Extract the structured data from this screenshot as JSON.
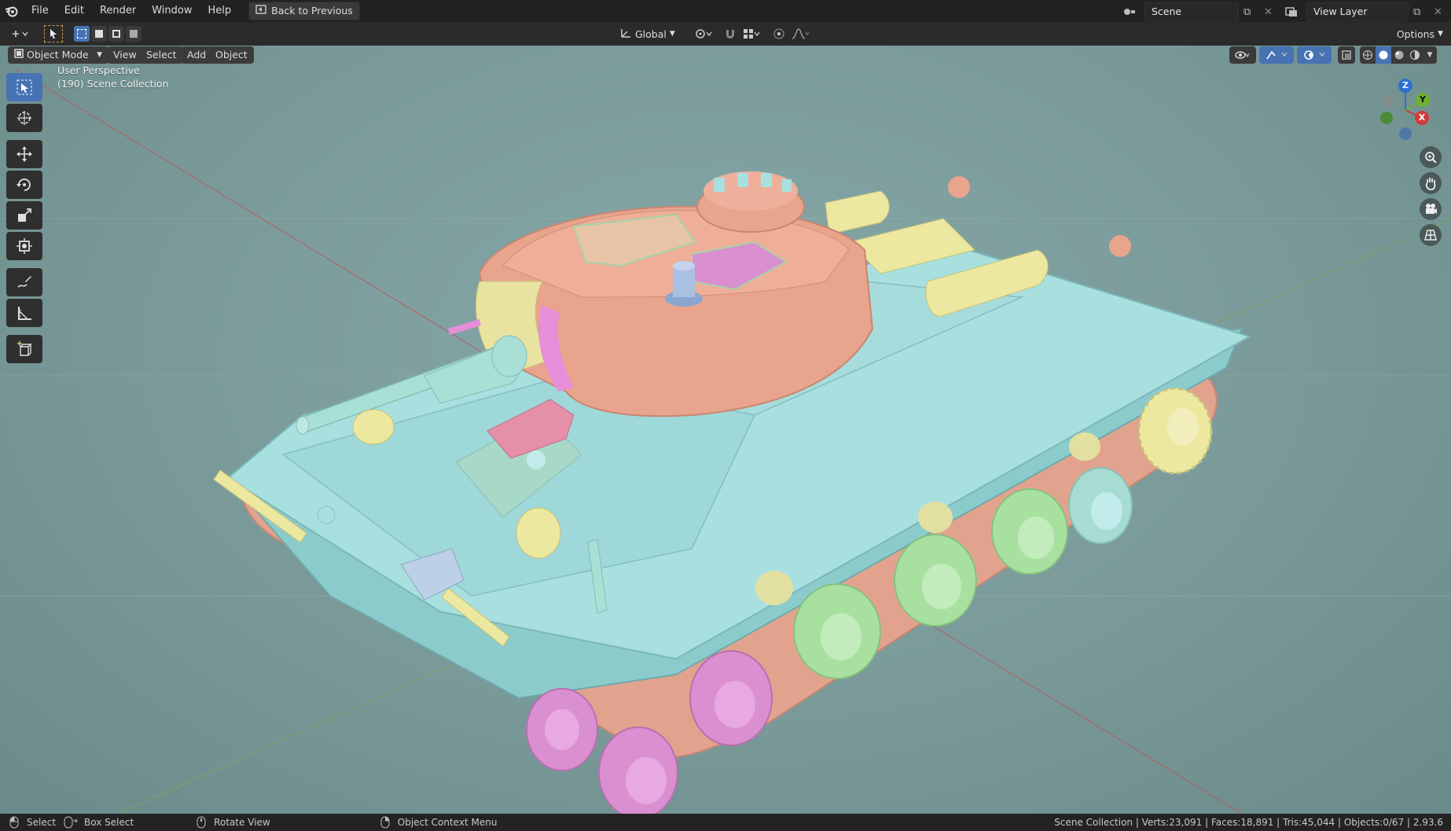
{
  "menu": {
    "items": [
      "File",
      "Edit",
      "Render",
      "Window",
      "Help"
    ],
    "back_button": "Back to Previous"
  },
  "scene": {
    "name": "Scene",
    "view_layer": "View Layer"
  },
  "transform": {
    "orientation": "Global"
  },
  "header": {
    "options_label": "Options",
    "mode_label": "Object Mode",
    "view_label": "View",
    "select_label": "Select",
    "add_label": "Add",
    "object_label": "Object"
  },
  "viewport": {
    "perspective": "User Perspective",
    "collection": "(190) Scene Collection"
  },
  "gizmo": {
    "z": "Z",
    "y": "Y",
    "x": "X"
  },
  "status": {
    "select": "Select",
    "box_select": "Box Select",
    "rotate_view": "Rotate View",
    "context_menu": "Object Context Menu",
    "stats": "Scene Collection | Verts:23,091 | Faces:18,891 | Tris:45,044 | Objects:0/67 | 2.93.6"
  },
  "colors": {
    "accent": "#4772b3",
    "hull": "#9edcdc",
    "turret": "#e8a48c",
    "track": "#e8a48c",
    "wheel_pink": "#d98fd0",
    "wheel_green": "#a8e0a0",
    "yellow": "#ece8a0"
  },
  "tools": [
    "select-box",
    "cursor",
    "move",
    "rotate",
    "scale",
    "transform",
    "annotate",
    "measure",
    "add-cube"
  ]
}
